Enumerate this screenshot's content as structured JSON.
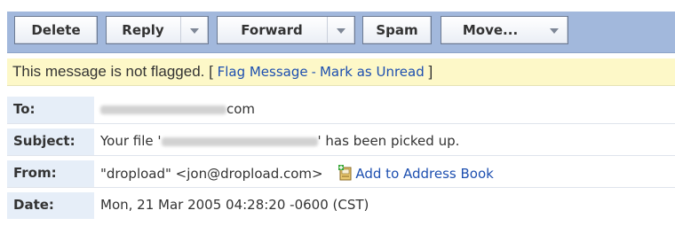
{
  "toolbar": {
    "delete_label": "Delete",
    "reply_label": "Reply",
    "forward_label": "Forward",
    "spam_label": "Spam",
    "move_label": "Move..."
  },
  "flag_bar": {
    "status_text": "This message is not flagged. [",
    "flag_link": "Flag Message",
    "separator": " - ",
    "unread_link": "Mark as Unread",
    "closing": " ]"
  },
  "headers": {
    "to_label": "To:",
    "to_value_suffix": "com",
    "subject_label": "Subject:",
    "subject_prefix": "Your file '",
    "subject_suffix": "' has been picked up.",
    "from_label": "From:",
    "from_value": "\"dropload\" <jon@dropload.com>",
    "add_to_address_book": "Add to Address Book",
    "date_label": "Date:",
    "date_value": "Mon, 21 Mar 2005 04:28:20 -0600 (CST)"
  },
  "icons": {
    "caret": "chevron-down-icon",
    "address_book": "address-book-icon"
  },
  "colors": {
    "toolbar_bg": "#a2b8dc",
    "flag_bar_bg": "#fdf8c8",
    "label_bg": "#e6eef8",
    "link": "#1d4fb0"
  }
}
